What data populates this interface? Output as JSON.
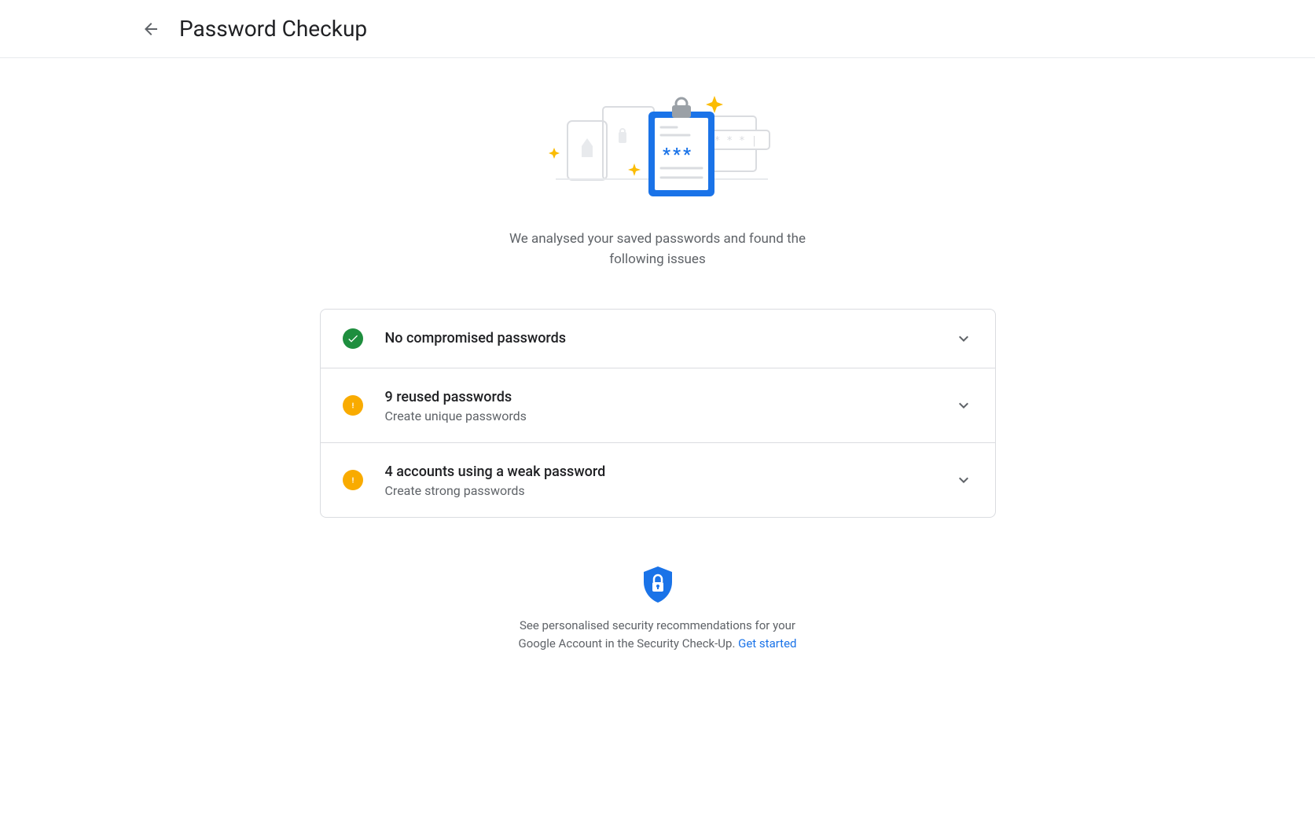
{
  "header": {
    "title": "Password Checkup"
  },
  "intro": "We analysed your saved passwords and found the following issues",
  "issues": [
    {
      "status": "ok",
      "title": "No compromised passwords",
      "subtitle": ""
    },
    {
      "status": "warning",
      "title": "9 reused passwords",
      "subtitle": "Create unique passwords"
    },
    {
      "status": "warning",
      "title": "4 accounts using a weak password",
      "subtitle": "Create strong passwords"
    }
  ],
  "footer": {
    "text": "See personalised security recommendations for your Google Account in the Security Check-Up. ",
    "link_text": "Get started"
  }
}
